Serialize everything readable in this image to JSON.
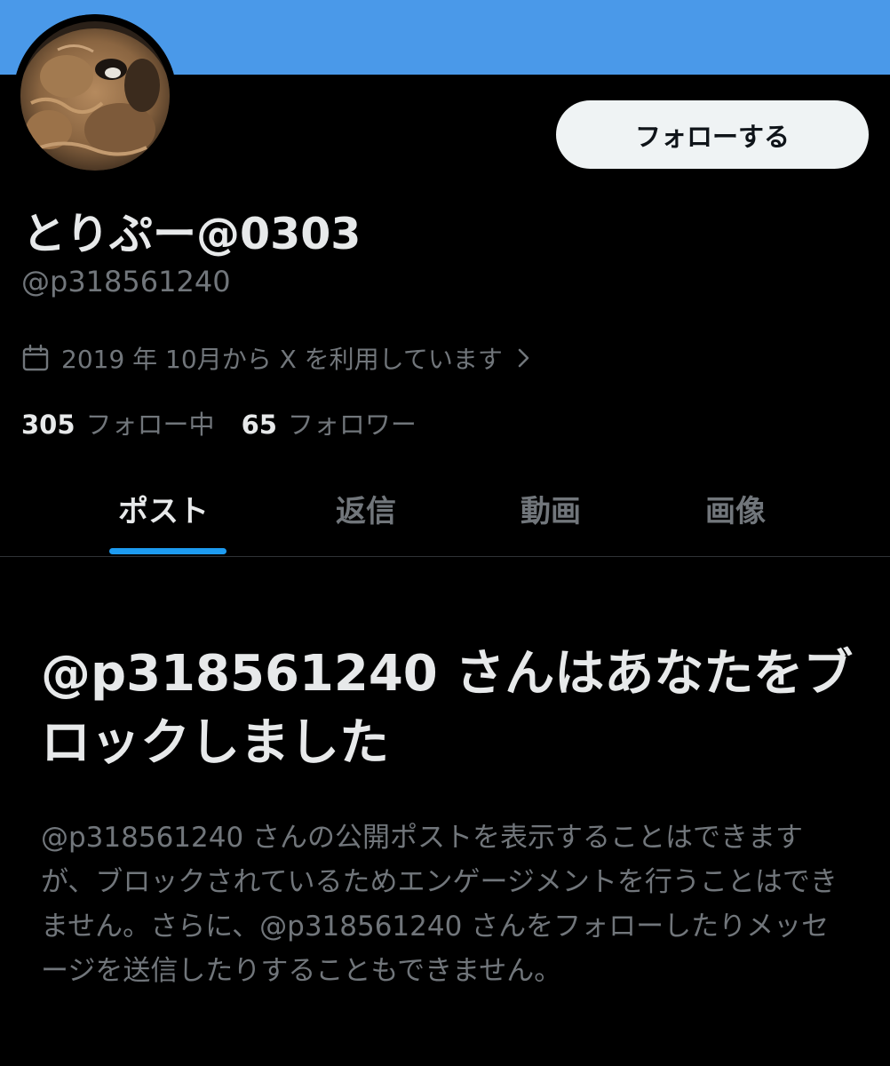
{
  "profile": {
    "display_name": "とりぷー@0303",
    "handle": "@p318561240",
    "joined": "2019 年 10月から X を利用しています",
    "follow_button_label": "フォローする"
  },
  "stats": {
    "following_count": "305",
    "following_label": "フォロー中",
    "followers_count": "65",
    "followers_label": "フォロワー"
  },
  "tabs": [
    {
      "label": "ポスト",
      "active": true
    },
    {
      "label": "返信",
      "active": false
    },
    {
      "label": "動画",
      "active": false
    },
    {
      "label": "画像",
      "active": false
    }
  ],
  "blocked": {
    "title": "@p318561240 さんはあなたをブロックしました",
    "description": "@p318561240 さんの公開ポストを表示することはできますが、ブロックされているためエンゲージメントを行うことはできません。さらに、@p318561240 さんをフォローしたりメッセージを送信したりすることもできません。"
  },
  "colors": {
    "banner": "#4a99e9",
    "background": "#000000",
    "accent": "#1d9bf0",
    "muted_text": "#71767b",
    "primary_text": "#e7e9ea"
  },
  "icons": {
    "calendar": "calendar-icon",
    "chevron": "chevron-right-icon"
  }
}
